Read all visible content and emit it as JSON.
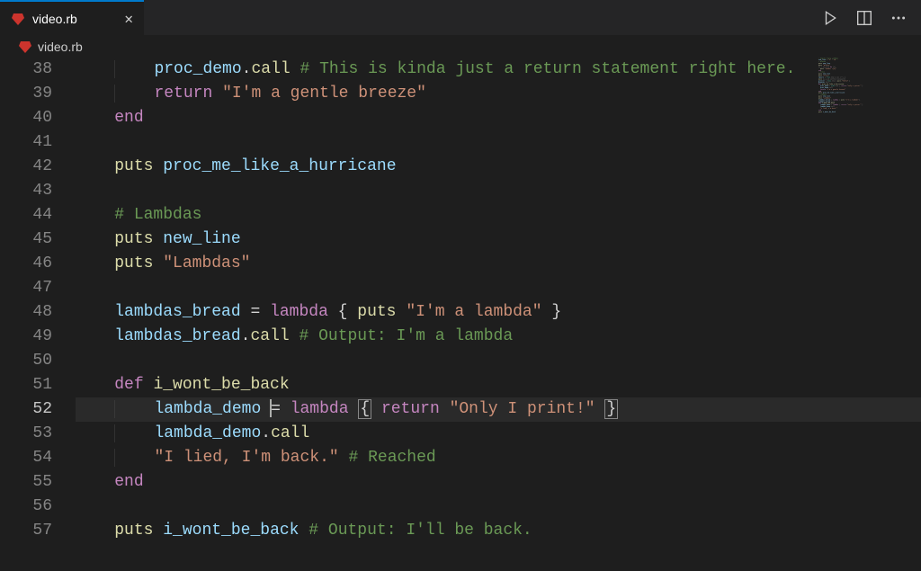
{
  "tab": {
    "filename": "video.rb",
    "close_label": "✕"
  },
  "breadcrumb": {
    "filename": "video.rb"
  },
  "lines": {
    "l38": {
      "num": "38",
      "segs": [
        "proc_demo",
        ".",
        "call",
        " ",
        "# This is kinda just a return statement right here."
      ]
    },
    "l39": {
      "num": "39",
      "segs": [
        "return",
        " ",
        "\"I'm a gentle breeze\""
      ]
    },
    "l40": {
      "num": "40",
      "segs": [
        "end"
      ]
    },
    "l41": {
      "num": "41"
    },
    "l42": {
      "num": "42",
      "segs": [
        "puts",
        " ",
        "proc_me_like_a_hurricane"
      ]
    },
    "l43": {
      "num": "43"
    },
    "l44": {
      "num": "44",
      "segs": [
        "# Lambdas"
      ]
    },
    "l45": {
      "num": "45",
      "segs": [
        "puts",
        " ",
        "new_line"
      ]
    },
    "l46": {
      "num": "46",
      "segs": [
        "puts",
        " ",
        "\"Lambdas\""
      ]
    },
    "l47": {
      "num": "47"
    },
    "l48": {
      "num": "48",
      "segs": [
        "lambdas_bread",
        " = ",
        "lambda",
        " { ",
        "puts",
        " ",
        "\"I'm a lambda\"",
        " }"
      ]
    },
    "l49": {
      "num": "49",
      "segs": [
        "lambdas_bread",
        ".",
        "call",
        " ",
        "# Output: I'm a lambda"
      ]
    },
    "l50": {
      "num": "50"
    },
    "l51": {
      "num": "51",
      "segs": [
        "def",
        " ",
        "i_wont_be_back"
      ]
    },
    "l52": {
      "num": "52",
      "segs": [
        "lambda_demo",
        " ",
        "= ",
        "lambda",
        " ",
        "{",
        " ",
        "return",
        " ",
        "\"Only I print!\"",
        " ",
        "}"
      ]
    },
    "l53": {
      "num": "53",
      "segs": [
        "lambda_demo",
        ".",
        "call"
      ]
    },
    "l54": {
      "num": "54",
      "segs": [
        "\"I lied, I'm back.\"",
        " ",
        "# Reached"
      ]
    },
    "l55": {
      "num": "55",
      "segs": [
        "end"
      ]
    },
    "l56": {
      "num": "56"
    },
    "l57": {
      "num": "57",
      "segs": [
        "puts",
        " ",
        "i_wont_be_back",
        " ",
        "# Output: I'll be back."
      ]
    }
  }
}
